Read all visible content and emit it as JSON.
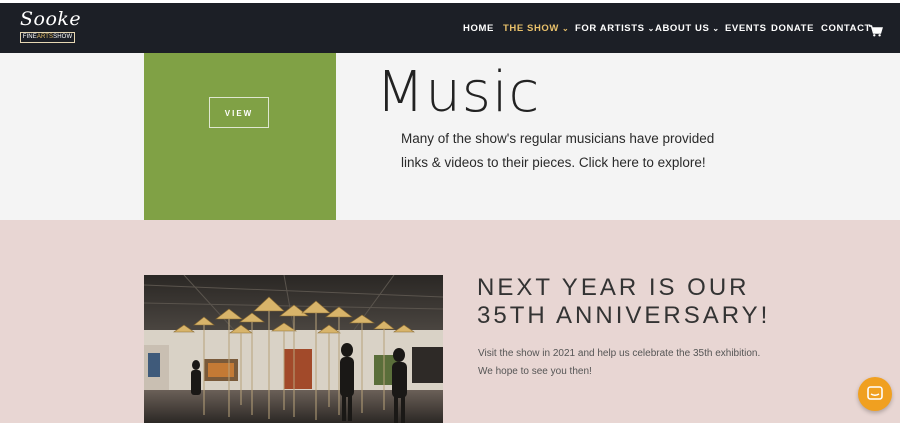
{
  "header": {
    "logo_script": "Sooke",
    "logo_box": {
      "part1": "FINE",
      "part2": "ARTS",
      "part3": "SHOW"
    },
    "nav": [
      {
        "label": "HOME",
        "dropdown": false,
        "active": false
      },
      {
        "label": "THE SHOW",
        "dropdown": true,
        "active": true
      },
      {
        "label": "FOR ARTISTS",
        "dropdown": true,
        "active": false
      },
      {
        "label": "ABOUT US",
        "dropdown": true,
        "active": false
      },
      {
        "label": "EVENTS",
        "dropdown": false,
        "active": false
      },
      {
        "label": "DONATE",
        "dropdown": false,
        "active": false
      },
      {
        "label": "CONTACT",
        "dropdown": false,
        "active": false
      }
    ],
    "cart_icon": "shopping-cart-icon"
  },
  "music": {
    "button_label": "VIEW",
    "title": "Music",
    "description": "Many of the show's regular musicians have provided links & videos to their pieces. Click here to explore!"
  },
  "anniversary": {
    "title_line1": "NEXT YEAR IS OUR",
    "title_line2": "35TH ANNIVERSARY!",
    "description": "Visit the show in 2021 and help us celebrate the 35th exhibition. We hope to see you then!"
  },
  "chat": {
    "icon": "chat-icon"
  },
  "colors": {
    "header_bg": "#1c1f26",
    "accent_gold": "#e8c06a",
    "green_card": "#80a145",
    "pink_bg": "#e8d6d3",
    "chat_orange": "#f0a020"
  }
}
